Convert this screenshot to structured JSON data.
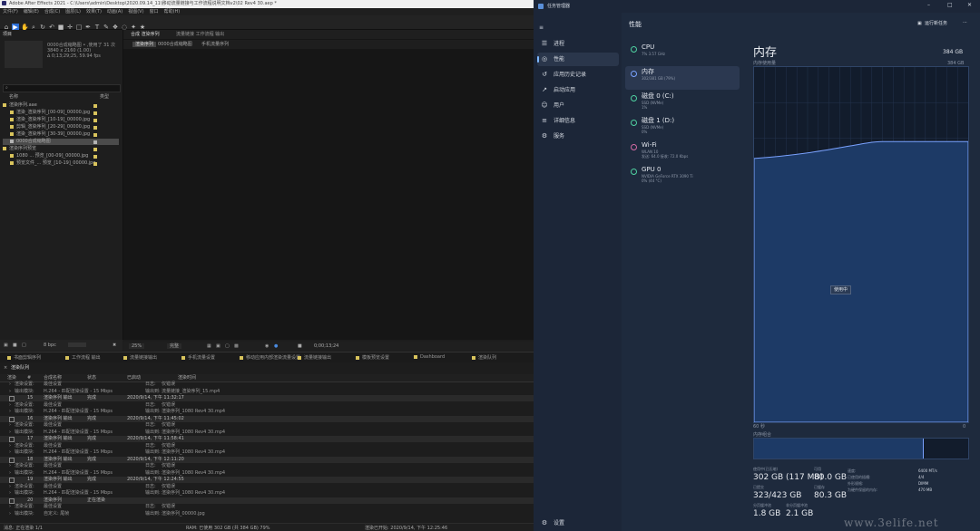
{
  "after_effects": {
    "title": "Adobe After Effects 2021 - C:\\Users\\admin\\Desktop\\2020.09.14_11\\移动流量链接与工作流程说明文档v2\\02 Rev4 30.aep *",
    "menu": [
      "文件(F)",
      "编辑(E)",
      "合成(C)",
      "图层(L)",
      "效果(T)",
      "动画(A)",
      "视图(V)",
      "窗口",
      "帮助(H)"
    ],
    "toolbar_icons": [
      "home-icon",
      "selection-tool-icon",
      "hand-tool-icon",
      "zoom-tool-icon",
      "rotate-tool-icon",
      "undo-icon",
      "camera-icon",
      "pan-icon",
      "rectangle-tool-icon",
      "pen-tool-icon",
      "type-tool-icon",
      "brush-tool-icon",
      "stamp-tool-icon",
      "eraser-tool-icon",
      "roto-tool-icon",
      "puppet-tool-icon"
    ],
    "project": {
      "label": "项目",
      "thumb_info": [
        "0000合成缩略图 • ,使用了 31 次",
        "3840 x 2160 (1.00)",
        "∆ 0;13;29;25, 59.94 fps"
      ],
      "search": "",
      "columns": [
        "名称",
        "类型"
      ],
      "items": [
        {
          "name": "渲染序列.aae",
          "type": "文件夹",
          "color": "#d9c45c"
        },
        {
          "name": "渲染_渲染序列_[00-09]_00000.jpg",
          "type": "",
          "color": "#d9c45c"
        },
        {
          "name": "渲染_渲染序列_[10-19]_00000.jpg",
          "type": "",
          "color": "#d9c45c"
        },
        {
          "name": "剪辑_渲染序列_[20-29]_00000.jpg",
          "type": "",
          "color": "#d9c45c"
        },
        {
          "name": "渲染_渲染序列_[30-39]_00000.jpg",
          "type": "",
          "color": "#d9c45c"
        },
        {
          "name": "0000合成缩略图",
          "type": "",
          "color": "#b3b3b3"
        },
        {
          "name": "渲染序列预览",
          "type": "文件夹",
          "color": "#d9c45c"
        },
        {
          "name": "1080 ... 预览_[00-09]_00000.jpg",
          "type": "",
          "color": "#d9c45c"
        },
        {
          "name": "预览文件_... 预览_[10-19]_00000.jpg",
          "type": "",
          "color": "#d9c45c"
        }
      ],
      "bpc": "8 bpc"
    },
    "composition": {
      "tabs": [
        "合成 渲染序列",
        "流量链接 工作流程 输出"
      ],
      "sub_tabs": [
        "渲染序列",
        "0000合成缩略图",
        "手机流量序列"
      ],
      "zoom": "25%",
      "quality": "完整",
      "timecode": "0;00;13;24"
    },
    "timeline_tabs": [
      "书面剪辑序列",
      "工作流程 输出",
      "流量链接输出",
      "手机流量设置",
      "移动应用内部渲染流量设置",
      "流量链接输出",
      "模板预览设置",
      "Dashboard",
      "渲染队列"
    ],
    "timeline": {
      "label": "渲染队列",
      "columns": [
        "渲染",
        "#",
        "合成名称",
        "状态",
        "已启动",
        "渲染时间"
      ],
      "rows": [
        {
          "kind": "sub",
          "a": "渲染设置:",
          "b": "最佳设置",
          "c": "日志:",
          "d": "仅错误"
        },
        {
          "kind": "sub",
          "a": "输出模块:",
          "b": "H.264 - 匹配渲染设置 - 15 Mbps",
          "c": "输出到:",
          "d": "流量链接_渲染序列_15.mp4"
        },
        {
          "kind": "layer",
          "a": "15",
          "b": "渲染序列 输出",
          "c": "完成",
          "d": "2020/9/14, 下午 11:32:17"
        },
        {
          "kind": "sub",
          "a": "渲染设置:",
          "b": "最佳设置",
          "c": "日志:",
          "d": "仅错误"
        },
        {
          "kind": "sub",
          "a": "输出模块:",
          "b": "H.264 - 匹配渲染设置 - 15 Mbps",
          "c": "输出到:",
          "d": "渲染序列_1080 Rev4 30.mp4"
        },
        {
          "kind": "layer",
          "a": "16",
          "b": "渲染序列 输出",
          "c": "完成",
          "d": "2020/9/14, 下午 11:45:02"
        },
        {
          "kind": "sub",
          "a": "渲染设置:",
          "b": "最佳设置",
          "c": "日志:",
          "d": "仅错误"
        },
        {
          "kind": "sub",
          "a": "输出模块:",
          "b": "H.264 - 匹配渲染设置 - 15 Mbps",
          "c": "输出到:",
          "d": "渲染序列_1080 Rev4 30.mp4"
        },
        {
          "kind": "layer",
          "a": "17",
          "b": "渲染序列 输出",
          "c": "完成",
          "d": "2020/9/14, 下午 11:58:41"
        },
        {
          "kind": "sub",
          "a": "渲染设置:",
          "b": "最佳设置",
          "c": "日志:",
          "d": "仅错误"
        },
        {
          "kind": "sub",
          "a": "输出模块:",
          "b": "H.264 - 匹配渲染设置 - 15 Mbps",
          "c": "输出到:",
          "d": "渲染序列_1080 Rev4 30.mp4"
        },
        {
          "kind": "layer",
          "a": "18",
          "b": "渲染序列 输出",
          "c": "完成",
          "d": "2020/9/14, 下午 12:11:20"
        },
        {
          "kind": "sub",
          "a": "渲染设置:",
          "b": "最佳设置",
          "c": "日志:",
          "d": "仅错误"
        },
        {
          "kind": "sub",
          "a": "输出模块:",
          "b": "H.264 - 匹配渲染设置 - 15 Mbps",
          "c": "输出到:",
          "d": "渲染序列_1080 Rev4 30.mp4"
        },
        {
          "kind": "layer",
          "a": "19",
          "b": "渲染序列 输出",
          "c": "完成",
          "d": "2020/9/14, 下午 12:24:55"
        },
        {
          "kind": "sub",
          "a": "渲染设置:",
          "b": "最佳设置",
          "c": "日志:",
          "d": "仅错误"
        },
        {
          "kind": "sub",
          "a": "输出模块:",
          "b": "H.264 - 匹配渲染设置 - 15 Mbps",
          "c": "输出到:",
          "d": "渲染序列_1080 Rev4 30.mp4"
        },
        {
          "kind": "layer",
          "a": "20",
          "b": "渲染序列",
          "c": "正在渲染",
          "d": ""
        },
        {
          "kind": "sub",
          "a": "渲染设置:",
          "b": "最佳设置",
          "c": "日志:",
          "d": "仅错误"
        },
        {
          "kind": "sub",
          "a": "输出模块:",
          "b": "自定义: 尾帧",
          "c": "输出到:",
          "d": "渲染序列_00000.jpg"
        }
      ]
    },
    "status": {
      "message": "消息: 正在渲染 1/1",
      "ram": "RAM: 已使用 302 GB (共 384 GB) 79%",
      "render_start": "渲染已开始: 2020/9/14, 下午 12:25:46"
    }
  },
  "task_manager": {
    "title": "任务管理器",
    "window_controls": [
      "minimize-icon",
      "maximize-icon",
      "close-icon"
    ],
    "header": "性能",
    "run_task": "运行新任务",
    "nav": [
      {
        "icon": "processes-icon",
        "glyph": "☰",
        "label": "进程"
      },
      {
        "icon": "performance-icon",
        "glyph": "◎",
        "label": "性能"
      },
      {
        "icon": "app-history-icon",
        "glyph": "↺",
        "label": "应用历史记录"
      },
      {
        "icon": "startup-icon",
        "glyph": "↗",
        "label": "启动应用"
      },
      {
        "icon": "users-icon",
        "glyph": "☺",
        "label": "用户"
      },
      {
        "icon": "details-icon",
        "glyph": "≡",
        "label": "详细信息"
      },
      {
        "icon": "services-icon",
        "glyph": "⚙",
        "label": "服务"
      }
    ],
    "settings": "设置",
    "devices": [
      {
        "name": "CPU",
        "sub": "7% 3.57 GHz",
        "color": "#4fd1a1"
      },
      {
        "name": "内存",
        "sub": "302/381 GB (79%)",
        "color": "#7aa2ff"
      },
      {
        "name": "磁盘 0 (C:)",
        "sub": "SSD (NVMe)\n1%",
        "color": "#4fd1a1"
      },
      {
        "name": "磁盘 1 (D:)",
        "sub": "SSD (NVMe)\n0%",
        "color": "#4fd1a1"
      },
      {
        "name": "Wi-Fi",
        "sub": "WLAN 10\n发送: 64.0 接收: 72.0 Kbps",
        "color": "#d46aa4"
      },
      {
        "name": "GPU 0",
        "sub": "NVIDIA GeForce RTX 3090 Ti\n0% (44 °C)",
        "color": "#4fd1a1"
      }
    ],
    "memory": {
      "title": "内存",
      "total": "384 GB",
      "graph_top": "384 GB",
      "usage_label": "内存使用量",
      "graph_left": "60 秒",
      "graph_right": "0",
      "in_use_pct": 79,
      "tooltip": "使用中",
      "composition_label": "内存组合",
      "stats": {
        "in_use_label": "使用中(已压缩)",
        "in_use": "302 GB (117 MB)",
        "available_label": "可用",
        "available": "80.0 GB",
        "committed_label": "已提交",
        "committed": "323/423 GB",
        "cached_label": "已缓存",
        "cached": "80.3 GB",
        "paged_label": "分页缓冲池",
        "paged": "1.8 GB",
        "nonpaged_label": "非分页缓冲池",
        "nonpaged": "2.1 GB"
      },
      "hardware": [
        {
          "k": "速度:",
          "v": "6400 MT/s"
        },
        {
          "k": "已使用的插槽:",
          "v": "4/4"
        },
        {
          "k": "外形规格:",
          "v": "DIMM"
        },
        {
          "k": "为硬件保留的内存:",
          "v": "470 MB"
        }
      ]
    },
    "watermark": "www.3elife.net"
  }
}
